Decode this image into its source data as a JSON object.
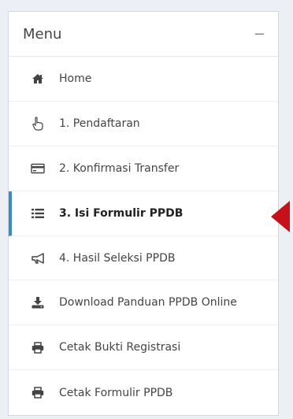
{
  "menu": {
    "title": "Menu",
    "collapse_symbol": "−",
    "items": [
      {
        "label": "Home",
        "icon": "home-icon",
        "active": false
      },
      {
        "label": "1. Pendaftaran",
        "icon": "hand-pointer-icon",
        "active": false
      },
      {
        "label": "2. Konfirmasi Transfer",
        "icon": "credit-card-icon",
        "active": false
      },
      {
        "label": "3. Isi Formulir PPDB",
        "icon": "list-icon",
        "active": true
      },
      {
        "label": "4. Hasil Seleksi PPDB",
        "icon": "bullhorn-icon",
        "active": false
      },
      {
        "label": "Download Panduan PPDB Online",
        "icon": "download-icon",
        "active": false
      },
      {
        "label": "Cetak Bukti Registrasi",
        "icon": "print-icon",
        "active": false
      },
      {
        "label": "Cetak Formulir PPDB",
        "icon": "print-icon",
        "active": false
      }
    ]
  },
  "colors": {
    "active_border": "#3c8dbc",
    "arrow": "#c8101b",
    "icon": "#444444"
  }
}
